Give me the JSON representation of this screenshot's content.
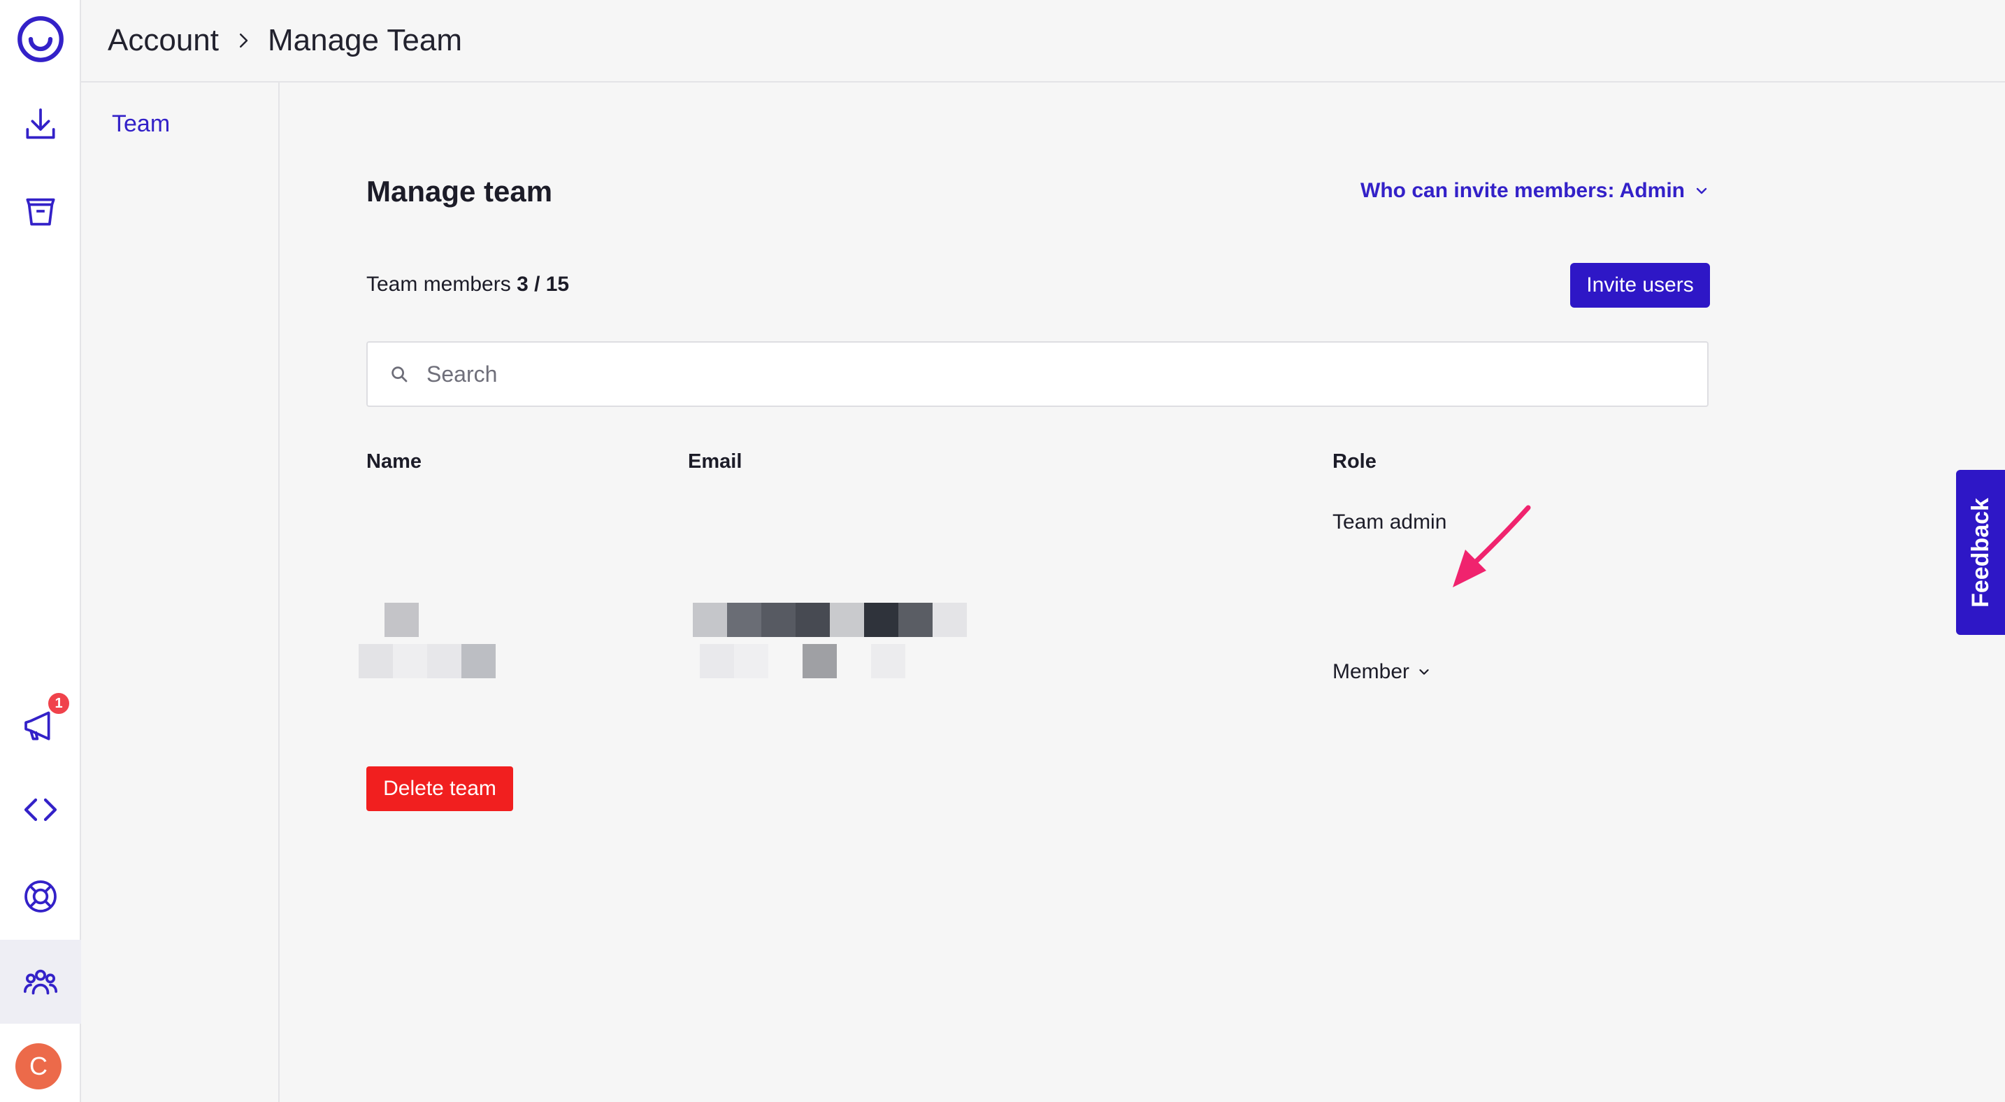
{
  "breadcrumb": {
    "parent": "Account",
    "current": "Manage Team"
  },
  "subnav": {
    "items": [
      {
        "label": "Team"
      }
    ]
  },
  "rail": {
    "icons": [
      "logo-icon",
      "download-icon",
      "archive-icon",
      "megaphone-icon",
      "code-icon",
      "lifebuoy-icon",
      "team-icon"
    ],
    "notification_count": "1",
    "avatar_initial": "C"
  },
  "main": {
    "title": "Manage team",
    "invite_permission": "Who can invite members: Admin",
    "members_label": "Team members",
    "members_count": "3 / 15",
    "invite_button": "Invite users",
    "search_placeholder": "Search",
    "columns": {
      "name": "Name",
      "email": "Email",
      "role": "Role"
    },
    "rows": [
      {
        "role": "Team admin"
      },
      {
        "role": "Member"
      }
    ],
    "delete_button": "Delete team"
  },
  "feedback": {
    "label": "Feedback"
  },
  "colors": {
    "accent": "#2e17c6",
    "danger": "#f11f1f",
    "annotation_arrow": "#f0236e"
  }
}
